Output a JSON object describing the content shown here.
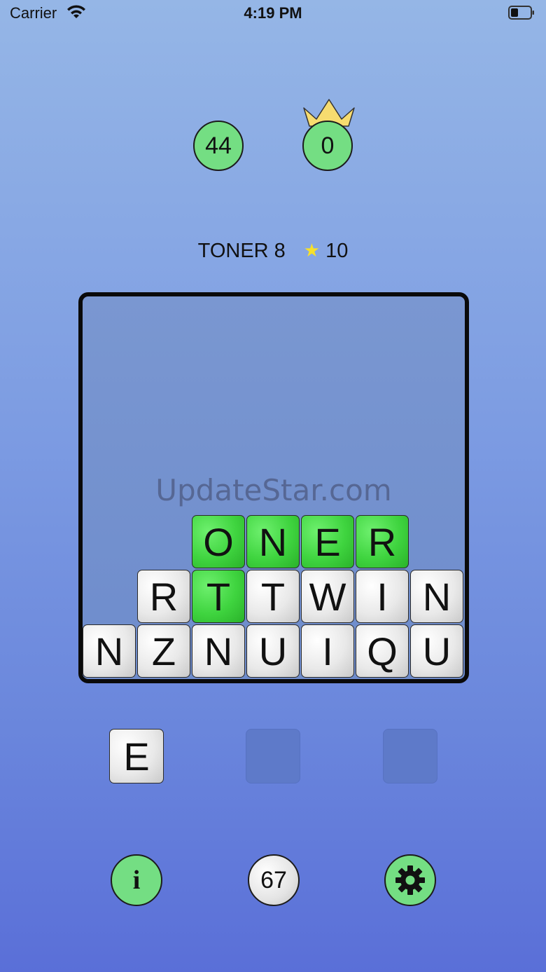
{
  "status_bar": {
    "carrier": "Carrier",
    "time": "4:19 PM"
  },
  "scores": {
    "current": "44",
    "best": "0"
  },
  "word_info": {
    "word": "TONER 8",
    "star_points": "10"
  },
  "watermark": "UpdateStar.com",
  "board": {
    "rows": [
      {
        "row": "top",
        "tiles": [
          {
            "letter": "O",
            "state": "selected"
          },
          {
            "letter": "N",
            "state": "selected"
          },
          {
            "letter": "E",
            "state": "selected"
          },
          {
            "letter": "R",
            "state": "selected"
          }
        ]
      },
      {
        "row": "middle",
        "tiles": [
          {
            "letter": "R",
            "state": "normal"
          },
          {
            "letter": "T",
            "state": "selected"
          },
          {
            "letter": "T",
            "state": "normal"
          },
          {
            "letter": "W",
            "state": "normal"
          },
          {
            "letter": "I",
            "state": "normal"
          },
          {
            "letter": "N",
            "state": "normal"
          }
        ]
      },
      {
        "row": "bottom",
        "tiles": [
          {
            "letter": "N",
            "state": "normal"
          },
          {
            "letter": "Z",
            "state": "normal"
          },
          {
            "letter": "N",
            "state": "normal"
          },
          {
            "letter": "U",
            "state": "normal"
          },
          {
            "letter": "I",
            "state": "normal"
          },
          {
            "letter": "Q",
            "state": "normal"
          },
          {
            "letter": "U",
            "state": "normal"
          }
        ]
      }
    ]
  },
  "next_tiles": [
    {
      "letter": "E"
    },
    {
      "letter": ""
    },
    {
      "letter": ""
    }
  ],
  "bottom_bar": {
    "info_label": "i",
    "remaining": "67",
    "settings_icon": "gear-icon"
  },
  "colors": {
    "selected_tile": "#3fd43f",
    "circle_green": "#74de83",
    "star": "#f7e12a",
    "crown": "#f7dc6f"
  }
}
